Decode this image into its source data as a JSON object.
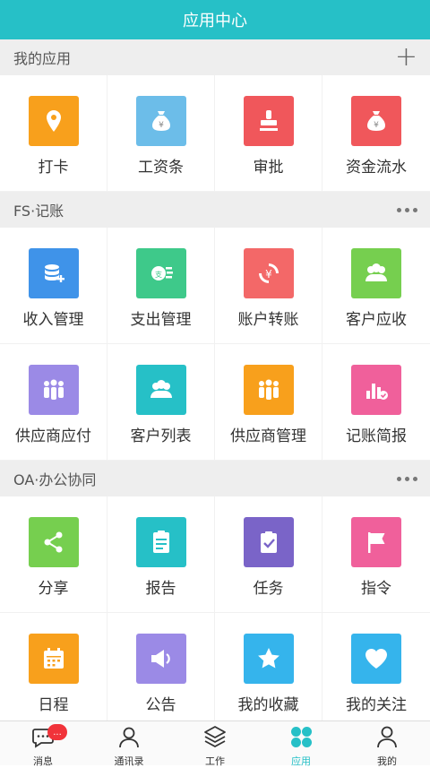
{
  "header": {
    "title": "应用中心"
  },
  "sections": [
    {
      "title": "我的应用",
      "items": [
        {
          "label": "打卡",
          "color": "#f8a01c",
          "icon": "location-pin-icon"
        },
        {
          "label": "工资条",
          "color": "#6cbde9",
          "icon": "money-bag-icon"
        },
        {
          "label": "审批",
          "color": "#f0575b",
          "icon": "stamp-icon"
        },
        {
          "label": "资金流水",
          "color": "#f0575b",
          "icon": "money-bag-icon"
        }
      ]
    },
    {
      "title": "FS·记账",
      "items": [
        {
          "label": "收入管理",
          "color": "#3f93e9",
          "icon": "coins-plus-icon"
        },
        {
          "label": "支出管理",
          "color": "#3ec98a",
          "icon": "coin-payout-icon"
        },
        {
          "label": "账户转账",
          "color": "#f36868",
          "icon": "currency-exchange-icon"
        },
        {
          "label": "客户应收",
          "color": "#76cf4f",
          "icon": "customers-icon"
        },
        {
          "label": "供应商应付",
          "color": "#9b8ae6",
          "icon": "group-icon"
        },
        {
          "label": "客户列表",
          "color": "#26c0c7",
          "icon": "customers-icon"
        },
        {
          "label": "供应商管理",
          "color": "#f8a01c",
          "icon": "group-icon"
        },
        {
          "label": "记账简报",
          "color": "#f0609b",
          "icon": "bar-report-icon"
        }
      ]
    },
    {
      "title": "OA·办公协同",
      "items": [
        {
          "label": "分享",
          "color": "#76cf4f",
          "icon": "share-icon"
        },
        {
          "label": "报告",
          "color": "#26c0c7",
          "icon": "report-icon"
        },
        {
          "label": "任务",
          "color": "#7a64c8",
          "icon": "task-icon"
        },
        {
          "label": "指令",
          "color": "#f0609b",
          "icon": "flag-icon"
        },
        {
          "label": "日程",
          "color": "#f8a01c",
          "icon": "calendar-icon"
        },
        {
          "label": "公告",
          "color": "#9b8ae6",
          "icon": "speaker-icon"
        },
        {
          "label": "我的收藏",
          "color": "#35b4ec",
          "icon": "star-icon"
        },
        {
          "label": "我的关注",
          "color": "#35b4ec",
          "icon": "heart-icon"
        }
      ]
    }
  ],
  "tabbar": [
    {
      "label": "消息",
      "icon": "chat-icon",
      "badge": "...",
      "active": false
    },
    {
      "label": "通讯录",
      "icon": "contacts-icon",
      "active": false
    },
    {
      "label": "工作",
      "icon": "layers-icon",
      "active": false
    },
    {
      "label": "应用",
      "icon": "apps-icon",
      "active": true
    },
    {
      "label": "我的",
      "icon": "profile-icon",
      "active": false
    }
  ],
  "colors": {
    "accent": "#26c0c7",
    "badge": "#f1333a"
  }
}
